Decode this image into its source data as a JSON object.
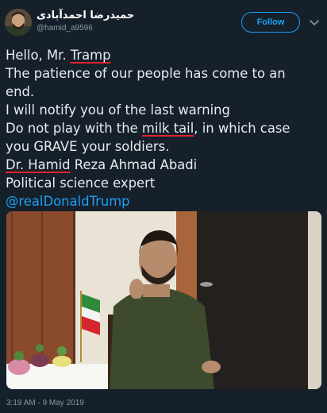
{
  "header": {
    "display_name": "حمیدرضا احمدآبادی",
    "handle": "@hamid_a9596",
    "follow_label": "Follow"
  },
  "tweet": {
    "line1_pre": "Hello, Mr. ",
    "line1_ul": "Tramp",
    "line2": "The patience of our people has come to an",
    "line3": "end.",
    "line4": "I will notify you of the last warning",
    "line5_pre": "Do not play with the ",
    "line5_ul": "milk tail",
    "line5_post": ", in which case",
    "line6": "you GRAVE your soldiers.",
    "line7_ul": "Dr. Hamid",
    "line7_post": " Reza Ahmad Abadi",
    "line8": "Political science expert",
    "mention": "@realDonaldTrump"
  },
  "timestamp": "3:19 AM - 9 May 2019",
  "colors": {
    "background": "#15202b",
    "accent": "#1da1f2",
    "underline": "#e0242b"
  },
  "icons": [
    "avatar-photo",
    "chevron-down-icon"
  ]
}
